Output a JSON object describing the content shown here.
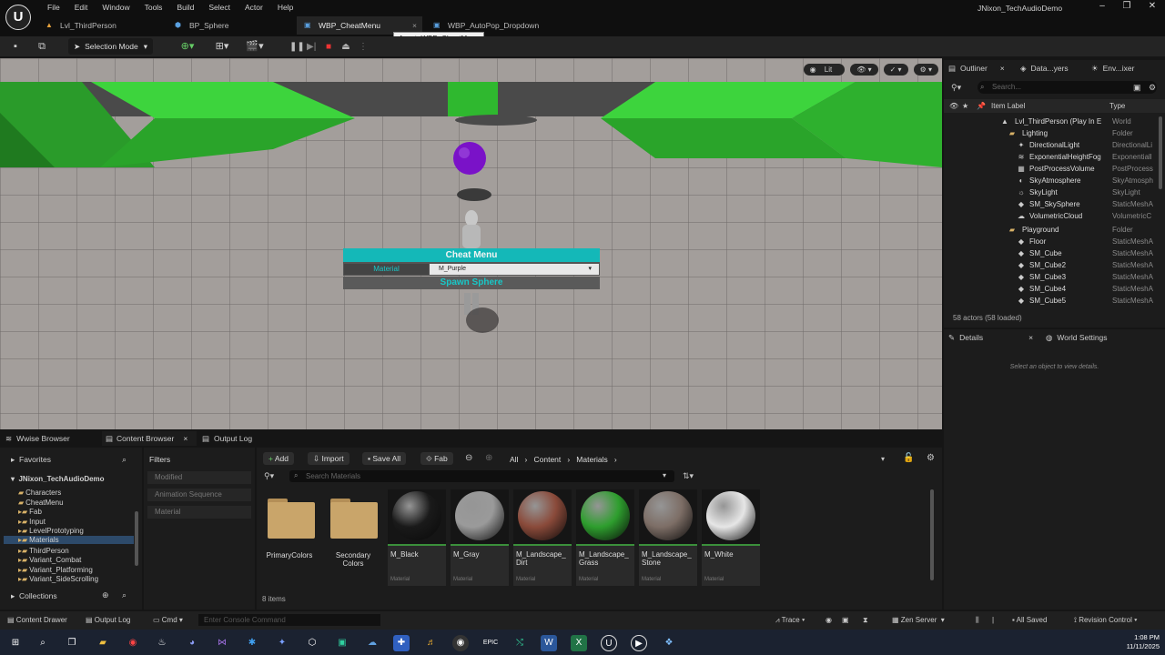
{
  "app": {
    "menu": [
      "File",
      "Edit",
      "Window",
      "Tools",
      "Build",
      "Select",
      "Actor",
      "Help"
    ],
    "project_title": "JNixon_TechAudioDemo",
    "tabs": [
      {
        "label": "Lvl_ThirdPerson"
      },
      {
        "label": "BP_Sphere"
      },
      {
        "label": "WBP_CheatMenu"
      },
      {
        "label": "WBP_AutoPop_Dropdown"
      }
    ],
    "tooltip": "Asset: WBP_CheatMenu"
  },
  "toolbar": {
    "selection_mode": "Selection Mode"
  },
  "viewport": {
    "lit": "Lit",
    "cheat_menu": {
      "title": "Cheat Menu",
      "material_label": "Material",
      "material_value": "M_Purple",
      "spawn_label": "Spawn Sphere"
    }
  },
  "outliner": {
    "tabs": [
      "Outliner",
      "Data...yers",
      "Env...ixer"
    ],
    "search_placeholder": "Search...",
    "col_label": "Item Label",
    "col_type": "Type",
    "rows": [
      {
        "label": "Lvl_ThirdPerson (Play In E",
        "type": "World"
      },
      {
        "label": "Lighting",
        "type": "Folder"
      },
      {
        "label": "DirectionalLight",
        "type": "DirectionalLi"
      },
      {
        "label": "ExponentialHeightFog",
        "type": "Exponentiall"
      },
      {
        "label": "PostProcessVolume",
        "type": "PostProcess"
      },
      {
        "label": "SkyAtmosphere",
        "type": "SkyAtmosph"
      },
      {
        "label": "SkyLight",
        "type": "SkyLight"
      },
      {
        "label": "SM_SkySphere",
        "type": "StaticMeshA"
      },
      {
        "label": "VolumetricCloud",
        "type": "VolumetricC"
      },
      {
        "label": "Playground",
        "type": "Folder"
      },
      {
        "label": "Floor",
        "type": "StaticMeshA"
      },
      {
        "label": "SM_Cube",
        "type": "StaticMeshA"
      },
      {
        "label": "SM_Cube2",
        "type": "StaticMeshA"
      },
      {
        "label": "SM_Cube3",
        "type": "StaticMeshA"
      },
      {
        "label": "SM_Cube4",
        "type": "StaticMeshA"
      },
      {
        "label": "SM_Cube5",
        "type": "StaticMeshA"
      }
    ],
    "actors_count": "58 actors (58 loaded)"
  },
  "details": {
    "tabs": [
      "Details",
      "World Settings"
    ],
    "hint": "Select an object to view details."
  },
  "bottom_tabs": [
    "Wwise Browser",
    "Content Browser",
    "Output Log"
  ],
  "content_browser": {
    "favorites": "Favorites",
    "project": "JNixon_TechAudioDemo",
    "folders": [
      "Characters",
      "CheatMenu",
      "Fab",
      "Input",
      "LevelPrototyping",
      "Materials",
      "ThirdPerson",
      "Variant_Combat",
      "Variant_Platforming",
      "Variant_SideScrolling"
    ],
    "collections": "Collections",
    "filters_title": "Filters",
    "filters": [
      "Modified",
      "Animation Sequence",
      "Material"
    ],
    "buttons": {
      "add": "Add",
      "import": "Import",
      "save_all": "Save All",
      "fab": "Fab"
    },
    "breadcrumb": [
      "All",
      "Content",
      "Materials"
    ],
    "search_placeholder": "Search Materials",
    "folder_assets": [
      {
        "name": "PrimaryColors"
      },
      {
        "name": "Secondary Colors"
      }
    ],
    "assets": [
      {
        "name": "M_Black",
        "kind": "Material",
        "color": "#1a1a1a"
      },
      {
        "name": "M_Gray",
        "kind": "Material",
        "color": "#9a9a9a"
      },
      {
        "name": "M_Landscape_ Dirt",
        "kind": "Material",
        "color": "#8a4a3a"
      },
      {
        "name": "M_Landscape_ Grass",
        "kind": "Material",
        "color": "#2e9e2e"
      },
      {
        "name": "M_Landscape_ Stone",
        "kind": "Material",
        "color": "#7d6e66"
      },
      {
        "name": "M_White",
        "kind": "Material",
        "color": "#e6e6e6"
      }
    ],
    "items_count": "8 items"
  },
  "statusbar": {
    "content_drawer": "Content Drawer",
    "output_log": "Output Log",
    "cmd": "Cmd",
    "console_placeholder": "Enter Console Command",
    "trace": "Trace",
    "zen": "Zen Server",
    "all_saved": "All Saved",
    "revision": "Revision Control"
  },
  "taskbar": {
    "time": "1:08 PM",
    "date": "11/11/2025"
  }
}
